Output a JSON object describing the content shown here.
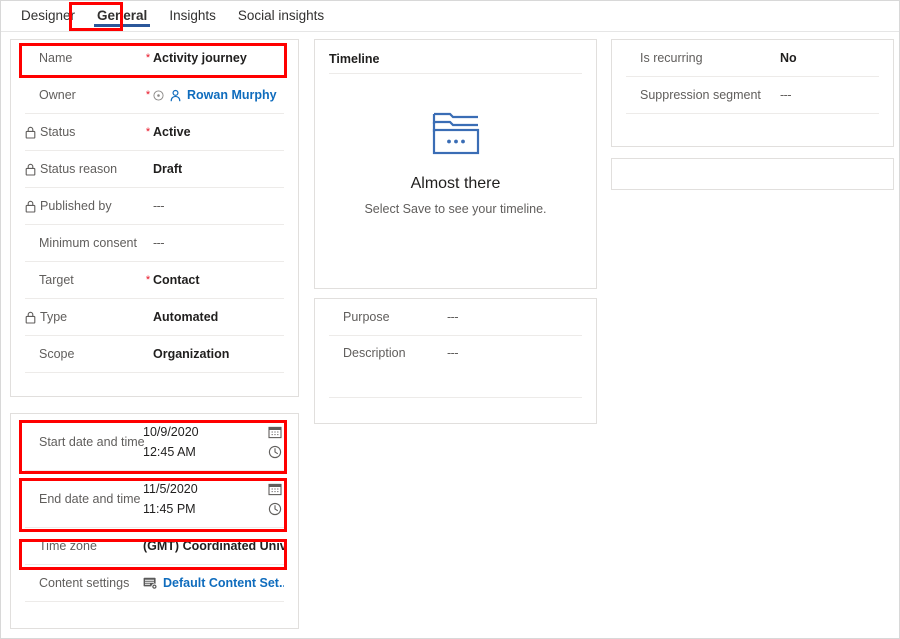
{
  "tabs": [
    {
      "label": "Designer",
      "selected": false
    },
    {
      "label": "General",
      "selected": true
    },
    {
      "label": "Insights",
      "selected": false
    },
    {
      "label": "Social insights",
      "selected": false
    }
  ],
  "main_card": {
    "rows": [
      {
        "label": "Name",
        "required": true,
        "locked": false,
        "value": "Activity journey",
        "style": "bold"
      },
      {
        "label": "Owner",
        "required": true,
        "locked": false,
        "value": "Rowan Murphy",
        "style": "link"
      },
      {
        "label": "Status",
        "required": true,
        "locked": true,
        "value": "Active",
        "style": "bold"
      },
      {
        "label": "Status reason",
        "required": false,
        "locked": true,
        "value": "Draft",
        "style": "bold"
      },
      {
        "label": "Published by",
        "required": false,
        "locked": true,
        "value": "---",
        "style": "dashes"
      },
      {
        "label": "Minimum consent",
        "required": false,
        "locked": false,
        "value": "---",
        "style": "dashes"
      },
      {
        "label": "Target",
        "required": true,
        "locked": false,
        "value": "Contact",
        "style": "bold"
      },
      {
        "label": "Type",
        "required": false,
        "locked": true,
        "value": "Automated",
        "style": "bold"
      },
      {
        "label": "Scope",
        "required": false,
        "locked": false,
        "value": "Organization",
        "style": "bold"
      }
    ]
  },
  "schedule_card": {
    "start": {
      "label": "Start date and time",
      "date": "10/9/2020",
      "time": "12:45 AM"
    },
    "end": {
      "label": "End date and time",
      "date": "11/5/2020",
      "time": "11:45 PM"
    },
    "timezone": {
      "label": "Time zone",
      "value": "(GMT) Coordinated Universal Time"
    },
    "content_settings": {
      "label": "Content settings",
      "value": "Default Content Set..."
    }
  },
  "timeline_card": {
    "title": "Timeline",
    "empty_title": "Almost there",
    "empty_subtitle": "Select Save to see your timeline."
  },
  "purpose_card": {
    "rows": [
      {
        "label": "Purpose",
        "value": "---"
      },
      {
        "label": "Description",
        "value": "---"
      }
    ]
  },
  "recurring_card": {
    "rows": [
      {
        "label": "Is recurring",
        "value": "No",
        "style": "bold"
      },
      {
        "label": "Suppression segment",
        "value": "---",
        "style": "dashes"
      }
    ]
  },
  "icons": {
    "lock": "lock-icon",
    "calendar": "calendar-icon",
    "clock": "clock-icon",
    "person": "person-icon",
    "presence": "presence-icon",
    "settings": "content-settings-icon",
    "empty_folder": "folder-stack-icon"
  },
  "colors": {
    "accent_blue": "#2b579a",
    "link_blue": "#0f6cbd",
    "highlight_red": "#ff0000",
    "required_red": "#e81123",
    "label_gray": "#605e5c",
    "border_gray": "#e1dfdd"
  }
}
